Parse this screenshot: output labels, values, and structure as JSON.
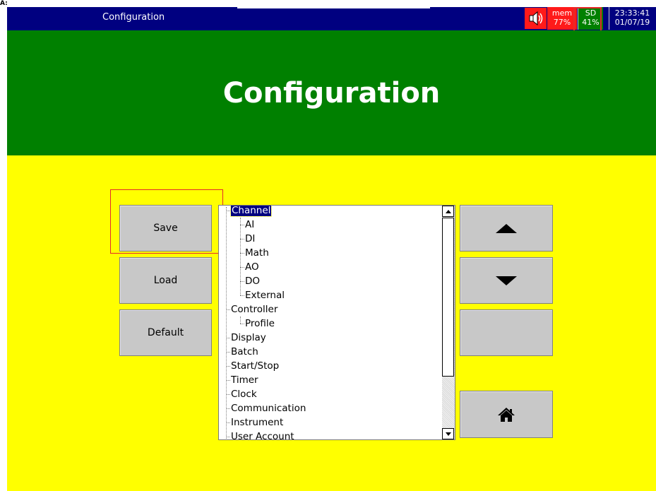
{
  "stray_mark": "A:",
  "topbar": {
    "title": "Configuration",
    "mem_label": "mem",
    "mem_value": "77%",
    "sd_label": "SD",
    "sd_value": "41%",
    "time": "23:33:41",
    "date": "01/07/19"
  },
  "header": {
    "title": "Configuration"
  },
  "buttons": {
    "save": "Save",
    "load": "Load",
    "default": "Default"
  },
  "tree": {
    "items": [
      {
        "label": "Channel",
        "level": 0,
        "selected": true
      },
      {
        "label": "AI",
        "level": 1
      },
      {
        "label": "DI",
        "level": 1
      },
      {
        "label": "Math",
        "level": 1
      },
      {
        "label": "AO",
        "level": 1
      },
      {
        "label": "DO",
        "level": 1
      },
      {
        "label": "External",
        "level": 1
      },
      {
        "label": "Controller",
        "level": 0
      },
      {
        "label": "Profile",
        "level": 1
      },
      {
        "label": "Display",
        "level": 0
      },
      {
        "label": "Batch",
        "level": 0
      },
      {
        "label": "Start/Stop",
        "level": 0
      },
      {
        "label": "Timer",
        "level": 0
      },
      {
        "label": "Clock",
        "level": 0
      },
      {
        "label": "Communication",
        "level": 0
      },
      {
        "label": "Instrument",
        "level": 0
      },
      {
        "label": "User Account",
        "level": 0
      }
    ]
  },
  "colors": {
    "background": "#ffff00",
    "header": "#008000",
    "topbar": "#000080",
    "highlight_box": "#e52a2a",
    "selection": "#000080"
  }
}
